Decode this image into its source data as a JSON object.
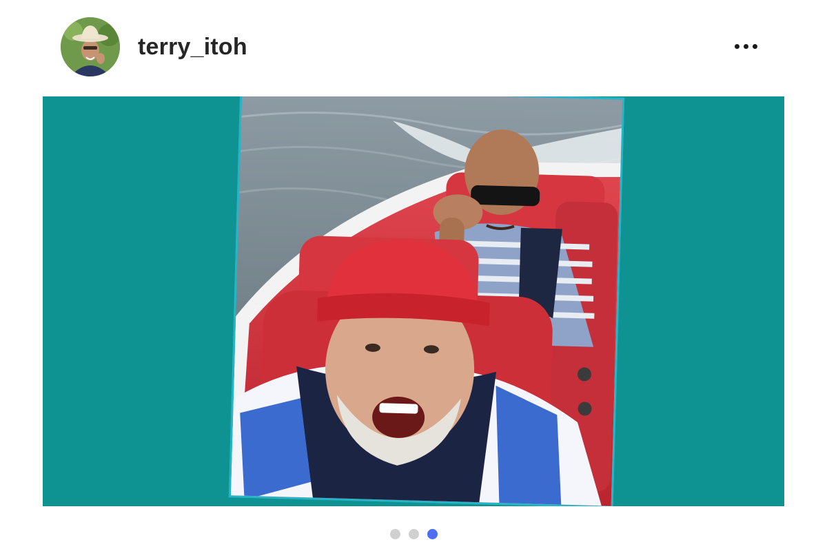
{
  "post": {
    "author": {
      "username": "terry_itoh",
      "avatar_icon": "profile-photo-icon"
    },
    "more_icon": "ellipsis-icon",
    "media": {
      "frame_color": "#0e9292",
      "photo_border_color": "#22b6c8"
    },
    "carousel": {
      "total_slides": 3,
      "active_index": 3,
      "active_color": "#4f6cf5",
      "inactive_color": "#d0d0d0"
    }
  }
}
